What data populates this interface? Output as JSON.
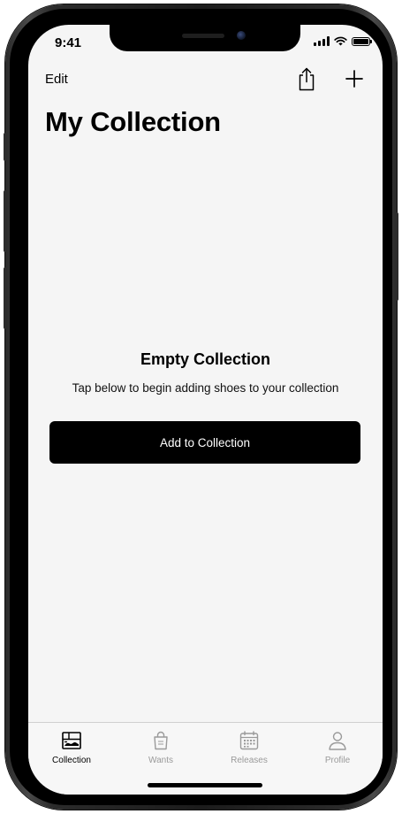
{
  "status_bar": {
    "time": "9:41"
  },
  "nav": {
    "edit_label": "Edit",
    "share_icon": "share-icon",
    "add_icon": "plus-icon"
  },
  "page": {
    "title": "My Collection"
  },
  "empty_state": {
    "title": "Empty Collection",
    "subtitle": "Tap below to begin adding shoes to your collection",
    "button_label": "Add to Collection"
  },
  "tab_bar": {
    "active_color": "#000000",
    "inactive_color": "#9a9a9a",
    "tabs": [
      {
        "label": "Collection",
        "icon": "shoebox-icon",
        "active": true
      },
      {
        "label": "Wants",
        "icon": "shopping-bag-icon",
        "active": false
      },
      {
        "label": "Releases",
        "icon": "calendar-icon",
        "active": false
      },
      {
        "label": "Profile",
        "icon": "person-icon",
        "active": false
      }
    ]
  }
}
